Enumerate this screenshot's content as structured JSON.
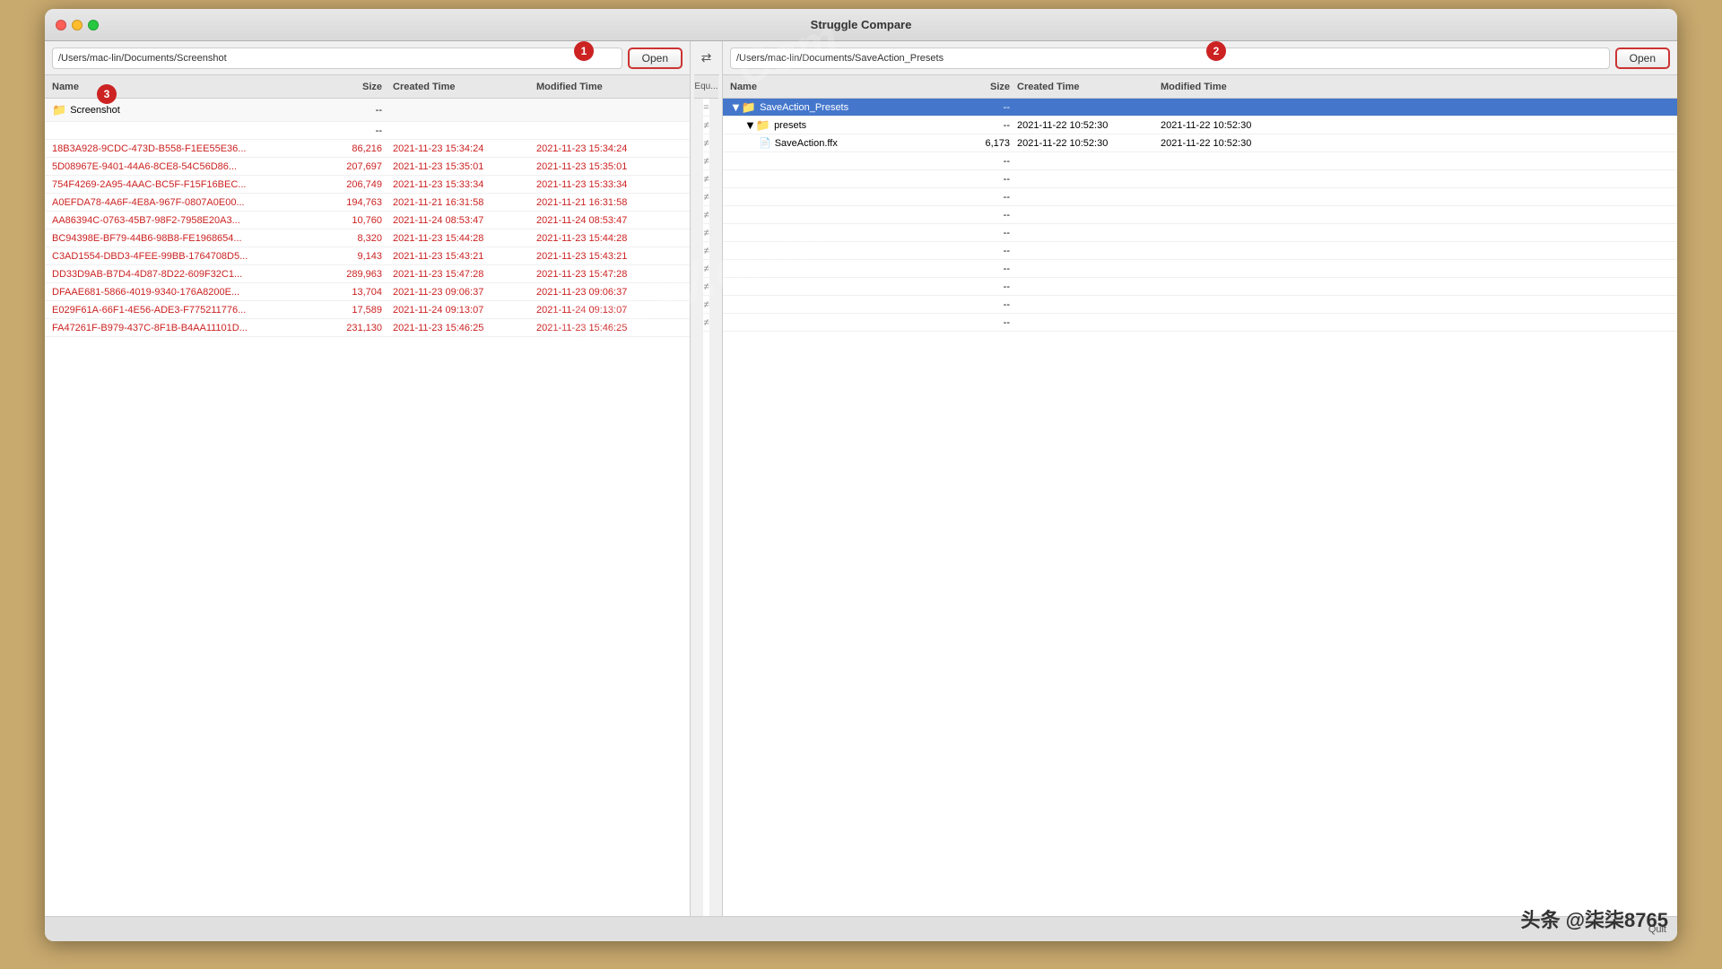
{
  "app": {
    "title": "Struggle Compare",
    "quit_label": "Quit"
  },
  "badges": {
    "b1": "1",
    "b2": "2",
    "b3": "3"
  },
  "left_pane": {
    "path": "/Users/mac-lin/Documents/Screenshot",
    "open_label": "Open",
    "headers": {
      "name": "Name",
      "size": "Size",
      "created": "Created Time",
      "modified": "Modified Time"
    },
    "folder": {
      "name": "Screenshot",
      "size": "--",
      "size2": "--"
    },
    "files": [
      {
        "name": "18B3A928-9CDC-473D-B558-F1EE55E36...",
        "size": "86,216",
        "created": "2021-11-23 15:34:24",
        "modified": "2021-11-23 15:34:24"
      },
      {
        "name": "5D08967E-9401-44A6-8CE8-54C56D86...",
        "size": "207,697",
        "created": "2021-11-23 15:35:01",
        "modified": "2021-11-23 15:35:01"
      },
      {
        "name": "754F4269-2A95-4AAC-BC5F-F15F16BEC...",
        "size": "206,749",
        "created": "2021-11-23 15:33:34",
        "modified": "2021-11-23 15:33:34"
      },
      {
        "name": "A0EFDA78-4A6F-4E8A-967F-0807A0E00...",
        "size": "194,763",
        "created": "2021-11-21 16:31:58",
        "modified": "2021-11-21 16:31:58"
      },
      {
        "name": "AA86394C-0763-45B7-98F2-7958E20A3...",
        "size": "10,760",
        "created": "2021-11-24 08:53:47",
        "modified": "2021-11-24 08:53:47"
      },
      {
        "name": "BC94398E-BF79-44B6-98B8-FE1968654...",
        "size": "8,320",
        "created": "2021-11-23 15:44:28",
        "modified": "2021-11-23 15:44:28"
      },
      {
        "name": "C3AD1554-DBD3-4FEE-99BB-1764708D5...",
        "size": "9,143",
        "created": "2021-11-23 15:43:21",
        "modified": "2021-11-23 15:43:21"
      },
      {
        "name": "DD33D9AB-B7D4-4D87-8D22-609F32C1...",
        "size": "289,963",
        "created": "2021-11-23 15:47:28",
        "modified": "2021-11-23 15:47:28"
      },
      {
        "name": "DFAAE681-5866-4019-9340-176A8200E...",
        "size": "13,704",
        "created": "2021-11-23 09:06:37",
        "modified": "2021-11-23 09:06:37"
      },
      {
        "name": "E029F61A-66F1-4E56-ADE3-F775211776...",
        "size": "17,589",
        "created": "2021-11-24 09:13:07",
        "modified": "2021-11-24 09:13:07"
      },
      {
        "name": "FA47261F-B979-437C-8F1B-B4AA11101D...",
        "size": "231,130",
        "created": "2021-11-23 15:46:25",
        "modified": "2021-11-23 15:46:25"
      }
    ]
  },
  "middle_pane": {
    "header": "Equ...",
    "symbols": [
      "=",
      "≠",
      "≠",
      "≠",
      "≠",
      "≠",
      "≠",
      "≠",
      "≠",
      "≠",
      "≠",
      "≠",
      "≠"
    ]
  },
  "right_pane": {
    "path": "/Users/mac-lin/Documents/SaveAction_Presets",
    "open_label": "Open",
    "headers": {
      "name": "Name",
      "size": "Size",
      "created": "Created Time",
      "modified": "Modified Time"
    },
    "items": [
      {
        "type": "folder",
        "name": "SaveAction_Presets",
        "selected": true,
        "size": "--",
        "created": "",
        "modified": "",
        "children": [
          {
            "type": "folder",
            "name": "presets",
            "size": "--",
            "created": "2021-11-22 10:52:30",
            "modified": "2021-11-22 10:52:30",
            "children": [
              {
                "type": "file",
                "name": "SaveAction.ffx",
                "size": "6,173",
                "created": "2021-11-22 10:52:30",
                "modified": "2021-11-22 10:52:30"
              }
            ]
          }
        ]
      }
    ],
    "empty_rows": 10
  },
  "watermarks": {
    "text1": "Com",
    "text2": "MacW.com",
    "text3": "MacW.com"
  }
}
